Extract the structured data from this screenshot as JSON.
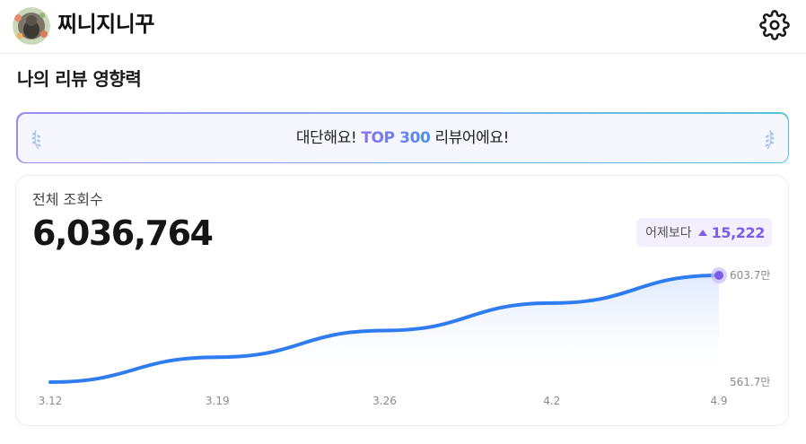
{
  "header": {
    "username": "찌니지니꾸",
    "settings_icon": "gear-icon"
  },
  "section": {
    "title": "나의 리뷰 영향력"
  },
  "banner": {
    "prefix": "대단해요! ",
    "highlight": "TOP 300",
    "suffix": " 리뷰어에요!"
  },
  "stats": {
    "label": "전체 조회수",
    "total": "6,036,764",
    "delta_label": "어제보다",
    "delta_value": "15,222",
    "delta_icon": "triangle-up-icon",
    "accent_color": "#7b5de8"
  },
  "chart_data": {
    "type": "area",
    "x": [
      "3.12",
      "3.19",
      "3.26",
      "4.2",
      "4.9"
    ],
    "values": [
      561.7,
      571.5,
      582.0,
      592.8,
      603.7
    ],
    "unit": "만",
    "ylim": [
      561.7,
      603.7
    ],
    "y_labels": [
      "603.7만",
      "561.7만"
    ],
    "line_color": "#2f7bf0",
    "marker_color": "#7b5de8",
    "grid": false,
    "legend": "none"
  }
}
